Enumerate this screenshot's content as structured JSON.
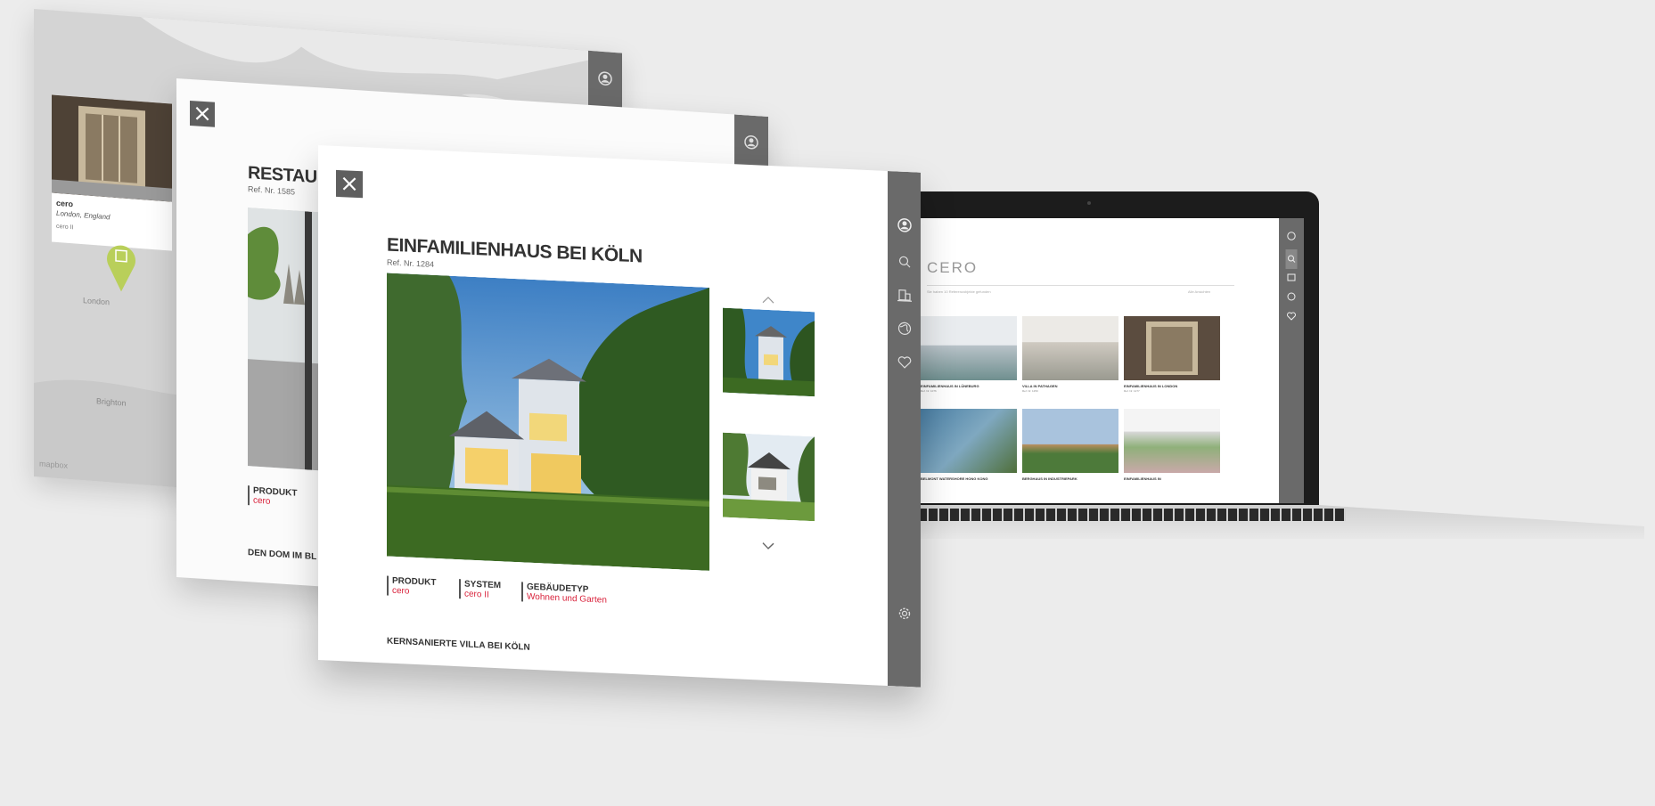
{
  "map_card": {
    "title": "cero",
    "location": "London, England",
    "system": "cero II",
    "map_labels": [
      "London",
      "Brighton"
    ],
    "map_credit": "mapbox",
    "sidebar_icons": [
      "user-icon"
    ]
  },
  "middle_card": {
    "title": "RESTAUR",
    "ref": "Ref. Nr. 1585",
    "meta": {
      "product_label": "PRODUKT",
      "product_value": "cero"
    },
    "section_title": "DEN DOM IM BL",
    "sidebar_icons": [
      "user-icon"
    ]
  },
  "front_card": {
    "title": "EINFAMILIENHAUS BEI KÖLN",
    "ref": "Ref. Nr. 1284",
    "meta": [
      {
        "label": "PRODUKT",
        "value": "cero"
      },
      {
        "label": "SYSTEM",
        "value": "cero II"
      },
      {
        "label": "GEBÄUDETYP",
        "value": "Wohnen und Garten"
      }
    ],
    "section_title": "KERNSANIERTE VILLA BEI KÖLN",
    "sidebar_icons": [
      "user-icon",
      "search-icon",
      "building-icon",
      "globe-icon",
      "heart-icon",
      "settings-icon"
    ]
  },
  "laptop": {
    "brand": "CERO",
    "subtitle": "Sie haben 10 Referenzobjekte gefunden",
    "right_link": "Alle Ansichten",
    "tiles": [
      {
        "title": "EINFAMILIENHAUS IN LÜNEBURG",
        "ref": "Ref. Nr. 1076"
      },
      {
        "title": "VILLA IN PATHAGEN",
        "ref": "Ref. Nr. 1250"
      },
      {
        "title": "EINFAMILIENHAUS IN LONDON",
        "ref": "Ref. Nr. 1277"
      },
      {
        "title": "BELMONT WATERSHORE HONG KONG",
        "ref": ""
      },
      {
        "title": "BERGHAUS IN INDUSTRIEPARK",
        "ref": ""
      },
      {
        "title": "EINFAMILIENHAUS IN",
        "ref": ""
      }
    ]
  },
  "colors": {
    "accent_red": "#d9223b",
    "sidebar_gray": "#6a6a6a",
    "pin_green": "#b9cf5a"
  }
}
